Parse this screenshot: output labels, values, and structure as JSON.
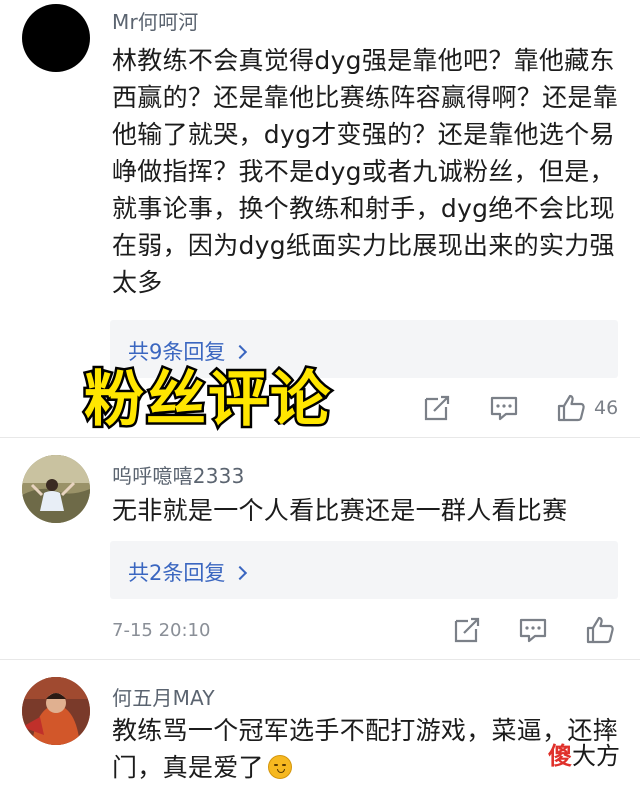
{
  "overlay_title": "粉丝评论",
  "comments": [
    {
      "username": "Mr何呵河",
      "text": "林教练不会真觉得dyg强是靠他吧？靠他藏东西赢的？还是靠他比赛练阵容赢得啊？还是靠他输了就哭，dyg才变强的？还是靠他选个易峥做指挥？我不是dyg或者九诚粉丝，但是，就事论事，换个教练和射手，dyg绝不会比现在弱，因为dyg纸面实力比展现出来的实力强太多",
      "replies_label": "共9条回复",
      "like_count": "46",
      "avatar_color": "#000000"
    },
    {
      "username": "呜呼噫嘻2333",
      "text": "无非就是一个人看比赛还是一群人看比赛",
      "replies_label": "共2条回复",
      "timestamp": "7-15 20:10",
      "avatar_color": "#8c8a5e"
    },
    {
      "username": "何五月MAY",
      "text": "教练骂一个冠军选手不配打游戏，菜逼，还摔门，真是爱了",
      "avatar_color": "#b5522e"
    }
  ],
  "icons": {
    "share": "share-icon",
    "comment": "comment-icon",
    "like": "thumbs-up-icon"
  },
  "watermark": {
    "part_a": "傻",
    "part_b": "大方"
  },
  "colors": {
    "link": "#3a66c0",
    "overlay_fill": "#ffe600",
    "overlay_stroke": "#000000"
  }
}
